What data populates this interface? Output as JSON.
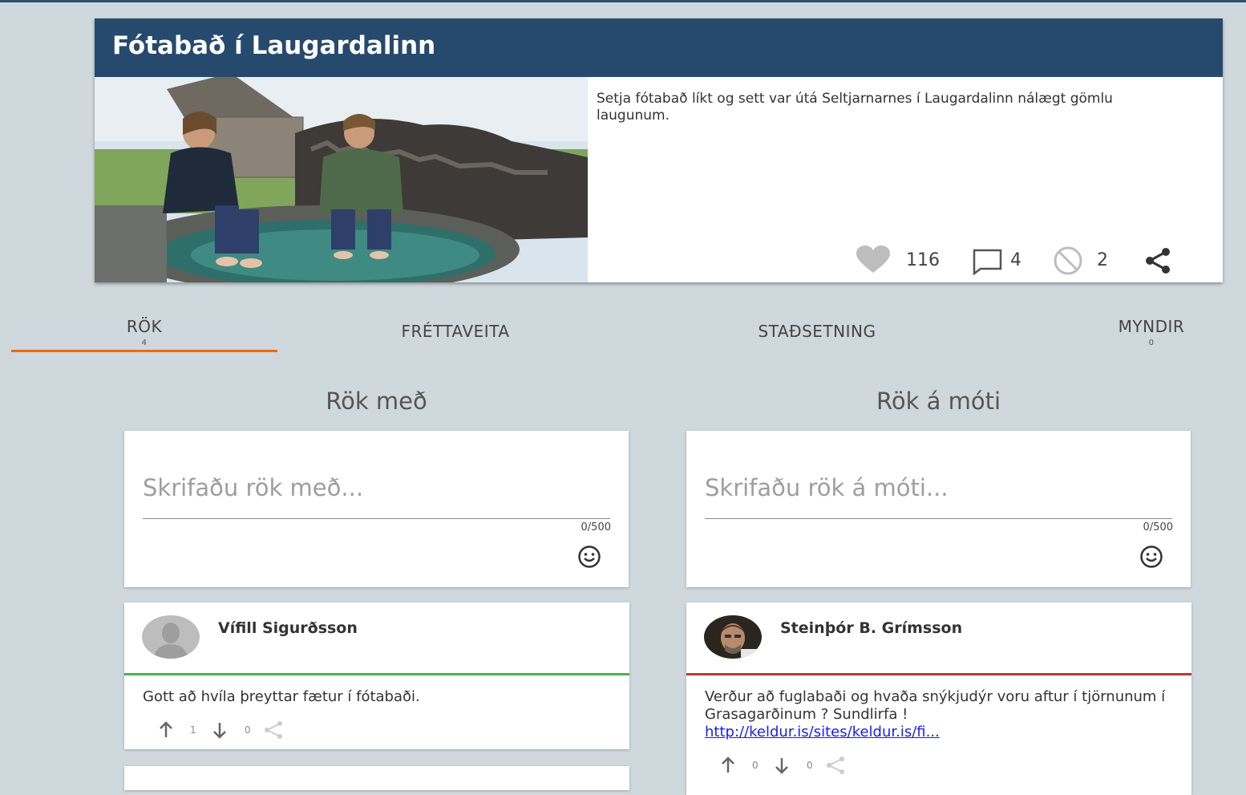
{
  "idea": {
    "title": "Fótabað í Laugardalinn",
    "description": "Setja fótabað líkt og sett var útá Seltjarnarnes í Laugardalinn nálægt gömlu laugunum.",
    "likes": "116",
    "comments": "4",
    "dislikes": "2"
  },
  "tabs": [
    {
      "label": "RÖK",
      "count": "4"
    },
    {
      "label": "FRÉTTAVEITA"
    },
    {
      "label": "STAÐSETNING"
    },
    {
      "label": "MYNDIR",
      "count": "0"
    }
  ],
  "columns": {
    "for": {
      "title": "Rök með",
      "placeholder": "Skrifaðu rök með...",
      "counter": "0/500"
    },
    "against": {
      "title": "Rök á móti",
      "placeholder": "Skrifaðu rök á móti...",
      "counter": "0/500"
    }
  },
  "arguments": {
    "for": [
      {
        "author": "Vífill Sigurðsson",
        "text": "Gott að hvíla þreyttar fætur í fótabaði.",
        "up": "1",
        "down": "0"
      }
    ],
    "against": [
      {
        "author": "Steinþór B. Grímsson",
        "text": "Verður að fuglabaði og hvaða snýkjudýr voru aftur í tjörnunum í Grasagarðinum ? Sundlirfa !",
        "link": "http://keldur.is/sites/keldur.is/fi...",
        "up": "0",
        "down": "0"
      }
    ]
  },
  "colors": {
    "header": "#264a6e",
    "tab_accent": "#ef6c00",
    "for_accent": "#4caf50",
    "against_accent": "#b23b3b",
    "background": "#cfd8dc"
  },
  "icons": [
    "heart-icon",
    "comment-icon",
    "block-icon",
    "share-icon",
    "emoji-icon",
    "vote-up-icon",
    "vote-down-icon",
    "avatar-placeholder-icon"
  ]
}
